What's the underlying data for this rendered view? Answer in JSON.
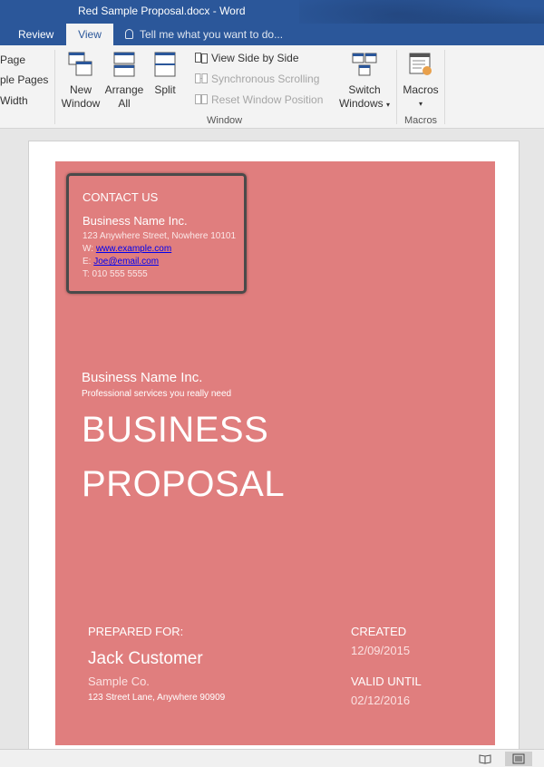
{
  "window": {
    "title": "Red Sample Proposal.docx - Word"
  },
  "tabs": {
    "review": "Review",
    "view": "View",
    "tell_me": "Tell me what you want to do..."
  },
  "ribbon": {
    "left_partial": {
      "one_page": "Page",
      "multiple_pages": "ple Pages",
      "page_width": "Width"
    },
    "new_window": [
      "New",
      "Window"
    ],
    "arrange_all": [
      "Arrange",
      "All"
    ],
    "split": "Split",
    "view_side_by_side": "View Side by Side",
    "synchronous_scrolling": "Synchronous Scrolling",
    "reset_window_position": "Reset Window Position",
    "window_group_label": "Window",
    "switch_windows": [
      "Switch",
      "Windows"
    ],
    "macros": "Macros",
    "macros_group_label": "Macros"
  },
  "document": {
    "contact": {
      "heading": "CONTACT US",
      "name": "Business Name Inc.",
      "address": "123 Anywhere Street, Nowhere 10101",
      "web_prefix": "W: ",
      "web": "www.example.com",
      "email_prefix": "E: ",
      "email": "Joe@email.com",
      "phone": "T: 010 555 5555"
    },
    "business_name": "Business Name Inc.",
    "tagline": "Professional services you really need",
    "title_line1": "BUSINESS",
    "title_line2": "PROPOSAL",
    "prepared_for_label": "PREPARED FOR:",
    "customer_name": "Jack Customer",
    "customer_company": "Sample Co.",
    "customer_address": "123 Street Lane, Anywhere 90909",
    "created_label": "CREATED",
    "created_date": "12/09/2015",
    "valid_until_label": "VALID UNTIL",
    "valid_until_date": "02/12/2016"
  },
  "colors": {
    "accent": "#2b579a",
    "cover": "#e07e7e"
  }
}
